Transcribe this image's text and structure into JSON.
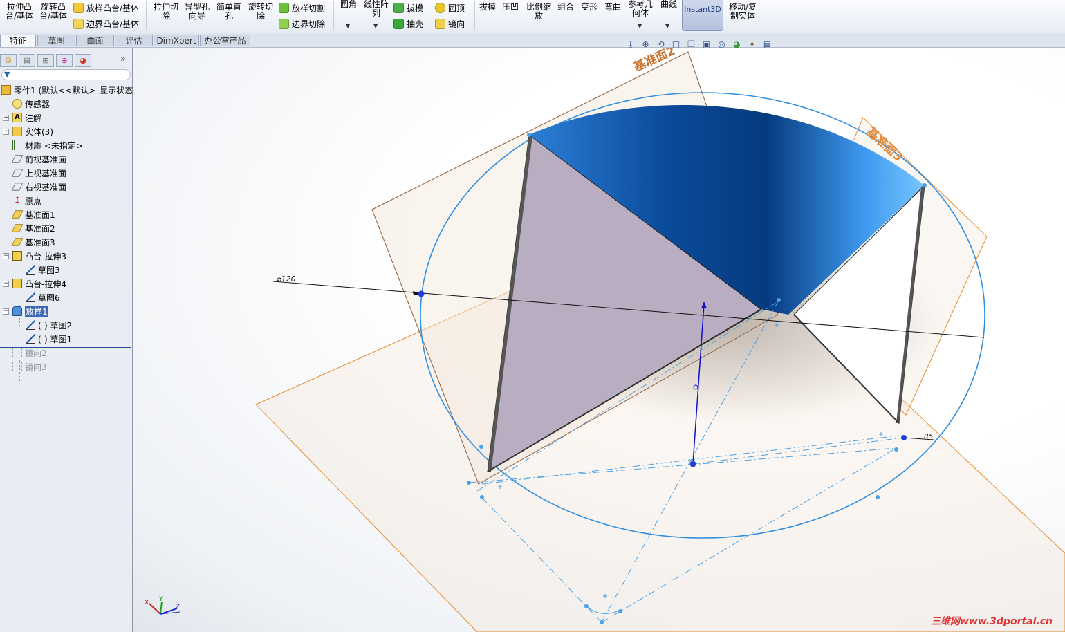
{
  "ribbon": {
    "big_buttons": [
      {
        "id": "extrude-boss",
        "line1": "拉伸凸",
        "line2": "台/基体"
      },
      {
        "id": "revolve-boss",
        "line1": "旋转凸",
        "line2": "台/基体"
      },
      {
        "id": "extrude-cut",
        "line1": "拉伸切",
        "line2": "除"
      },
      {
        "id": "hole-wizard",
        "line1": "异型孔",
        "line2": "向导"
      },
      {
        "id": "simple-hole",
        "line1": "简单直",
        "line2": "孔"
      },
      {
        "id": "revolve-cut",
        "line1": "旋转切",
        "line2": "除"
      },
      {
        "id": "fillet",
        "line1": "圆角",
        "line2": ""
      },
      {
        "id": "linear-pattern",
        "line1": "线性阵",
        "line2": "列"
      },
      {
        "id": "draft2",
        "line1": "拔模",
        "line2": ""
      },
      {
        "id": "indent",
        "line1": "压凹",
        "line2": ""
      },
      {
        "id": "scale",
        "line1": "比例缩",
        "line2": "放"
      },
      {
        "id": "combine",
        "line1": "组合",
        "line2": ""
      },
      {
        "id": "deform",
        "line1": "变形",
        "line2": ""
      },
      {
        "id": "flex",
        "line1": "弯曲",
        "line2": ""
      },
      {
        "id": "ref-geometry",
        "line1": "参考几",
        "line2": "何体"
      },
      {
        "id": "curves",
        "line1": "曲线",
        "line2": ""
      },
      {
        "id": "move-copy",
        "line1": "移动/复",
        "line2": "制实体"
      }
    ],
    "small_buttons": {
      "loft_boss": "放样凸台/基体",
      "boundary_boss": "边界凸台/基体",
      "loft_cut": "放样切割",
      "boundary_cut": "边界切除",
      "draft": "拔模",
      "shell": "抽壳",
      "dome": "圆顶",
      "mirror": "镜向"
    },
    "instant3d": "Instant3D"
  },
  "tabs": [
    "特征",
    "草图",
    "曲面",
    "评估",
    "DimXpert",
    "办公室产品"
  ],
  "tree": {
    "root": "零件1 (默认<<默认>_显示状态",
    "items": [
      {
        "label": "传感器"
      },
      {
        "label": "注解"
      },
      {
        "label": "实体(3)"
      },
      {
        "label": "材质 <未指定>"
      },
      {
        "label": "前视基准面"
      },
      {
        "label": "上视基准面"
      },
      {
        "label": "右视基准面"
      },
      {
        "label": "原点"
      },
      {
        "label": "基准面1"
      },
      {
        "label": "基准面2"
      },
      {
        "label": "基准面3"
      },
      {
        "label": "凸台-拉伸3"
      },
      {
        "label": "草图3"
      },
      {
        "label": "凸台-拉伸4"
      },
      {
        "label": "草图6"
      },
      {
        "label": "放样1"
      },
      {
        "label": "(-) 草图2"
      },
      {
        "label": "(-) 草图1"
      },
      {
        "label": "镜向2"
      },
      {
        "label": "镜向3"
      }
    ]
  },
  "viewport": {
    "plane2_label": "基准面2",
    "plane3_label": "基准面3",
    "dim_diameter": "⌀120",
    "dim_radius": "R5"
  },
  "watermark": "三维网www.3dportal.cn",
  "colors": {
    "accent": "#3f69b5",
    "sketch_blue": "#2f8ee0",
    "plane_orange": "#e88a2a",
    "surface_blue": "#0b4fa0",
    "face_mauve": "#b9adc1"
  }
}
